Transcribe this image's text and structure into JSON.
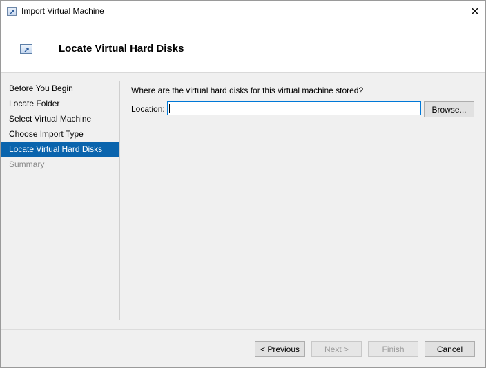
{
  "window": {
    "title": "Import Virtual Machine",
    "close_symbol": "✕"
  },
  "header": {
    "title": "Locate Virtual Hard Disks"
  },
  "nav": {
    "items": [
      {
        "label": "Before You Begin",
        "state": "normal"
      },
      {
        "label": "Locate Folder",
        "state": "normal"
      },
      {
        "label": "Select Virtual Machine",
        "state": "normal"
      },
      {
        "label": "Choose Import Type",
        "state": "normal"
      },
      {
        "label": "Locate Virtual Hard Disks",
        "state": "active"
      },
      {
        "label": "Summary",
        "state": "disabled"
      }
    ]
  },
  "content": {
    "question": "Where are the virtual hard disks for this virtual machine stored?",
    "location_label": "Location:",
    "location_value": "",
    "browse_label": "Browse..."
  },
  "footer": {
    "previous_label": "< Previous",
    "next_label": "Next >",
    "finish_label": "Finish",
    "cancel_label": "Cancel"
  },
  "colors": {
    "accent": "#0a64ad",
    "input_focus_border": "#0078d7"
  }
}
